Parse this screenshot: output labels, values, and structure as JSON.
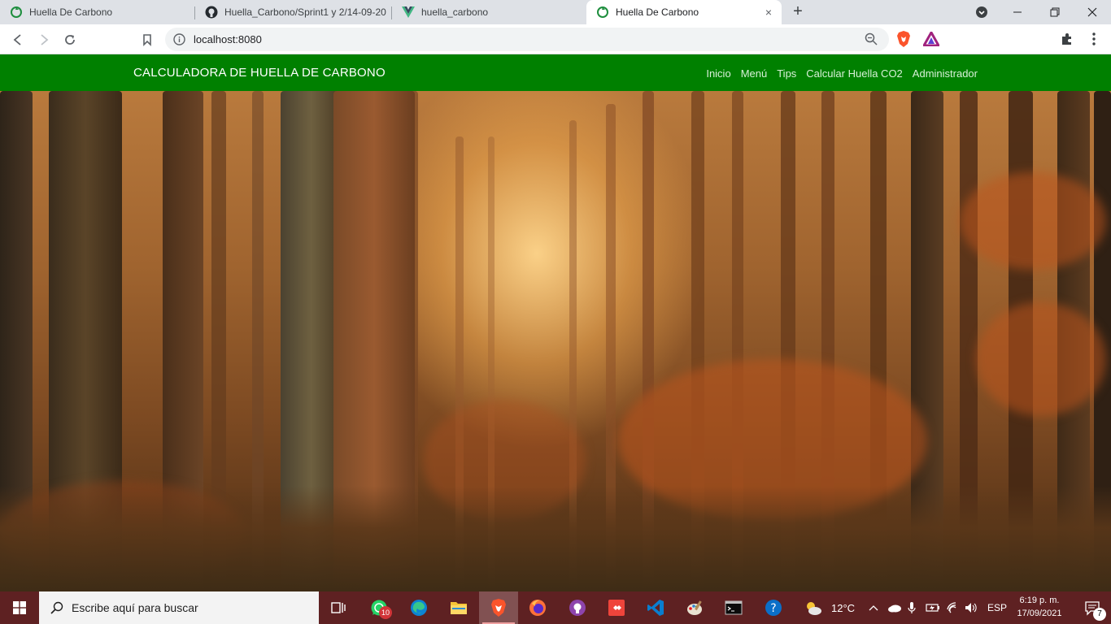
{
  "browser": {
    "tabs": [
      {
        "title": "Huella De Carbono",
        "favicon": "recycle-icon",
        "active": false
      },
      {
        "title": "Huella_Carbono/Sprint1 y 2/14-09-20",
        "favicon": "github-icon",
        "active": false
      },
      {
        "title": "huella_carbono",
        "favicon": "vue-icon",
        "active": false
      },
      {
        "title": "Huella De Carbono",
        "favicon": "recycle-icon",
        "active": true
      }
    ],
    "address": "localhost:8080",
    "close_glyph": "×",
    "new_tab_glyph": "+"
  },
  "page": {
    "brand": "CALCULADORA DE HUELLA DE CARBONO",
    "nav": [
      "Inicio",
      "Menú",
      "Tips",
      "Calcular Huella CO2",
      "Administrador"
    ],
    "navbar_color": "#008000"
  },
  "taskbar": {
    "search_placeholder": "Escribe aquí para buscar",
    "whatsapp_badge": "10",
    "weather": "12°C",
    "language": "ESP",
    "time": "6:19 p. m.",
    "date": "17/09/2021",
    "notifications": "7",
    "color": "#5e2122"
  }
}
